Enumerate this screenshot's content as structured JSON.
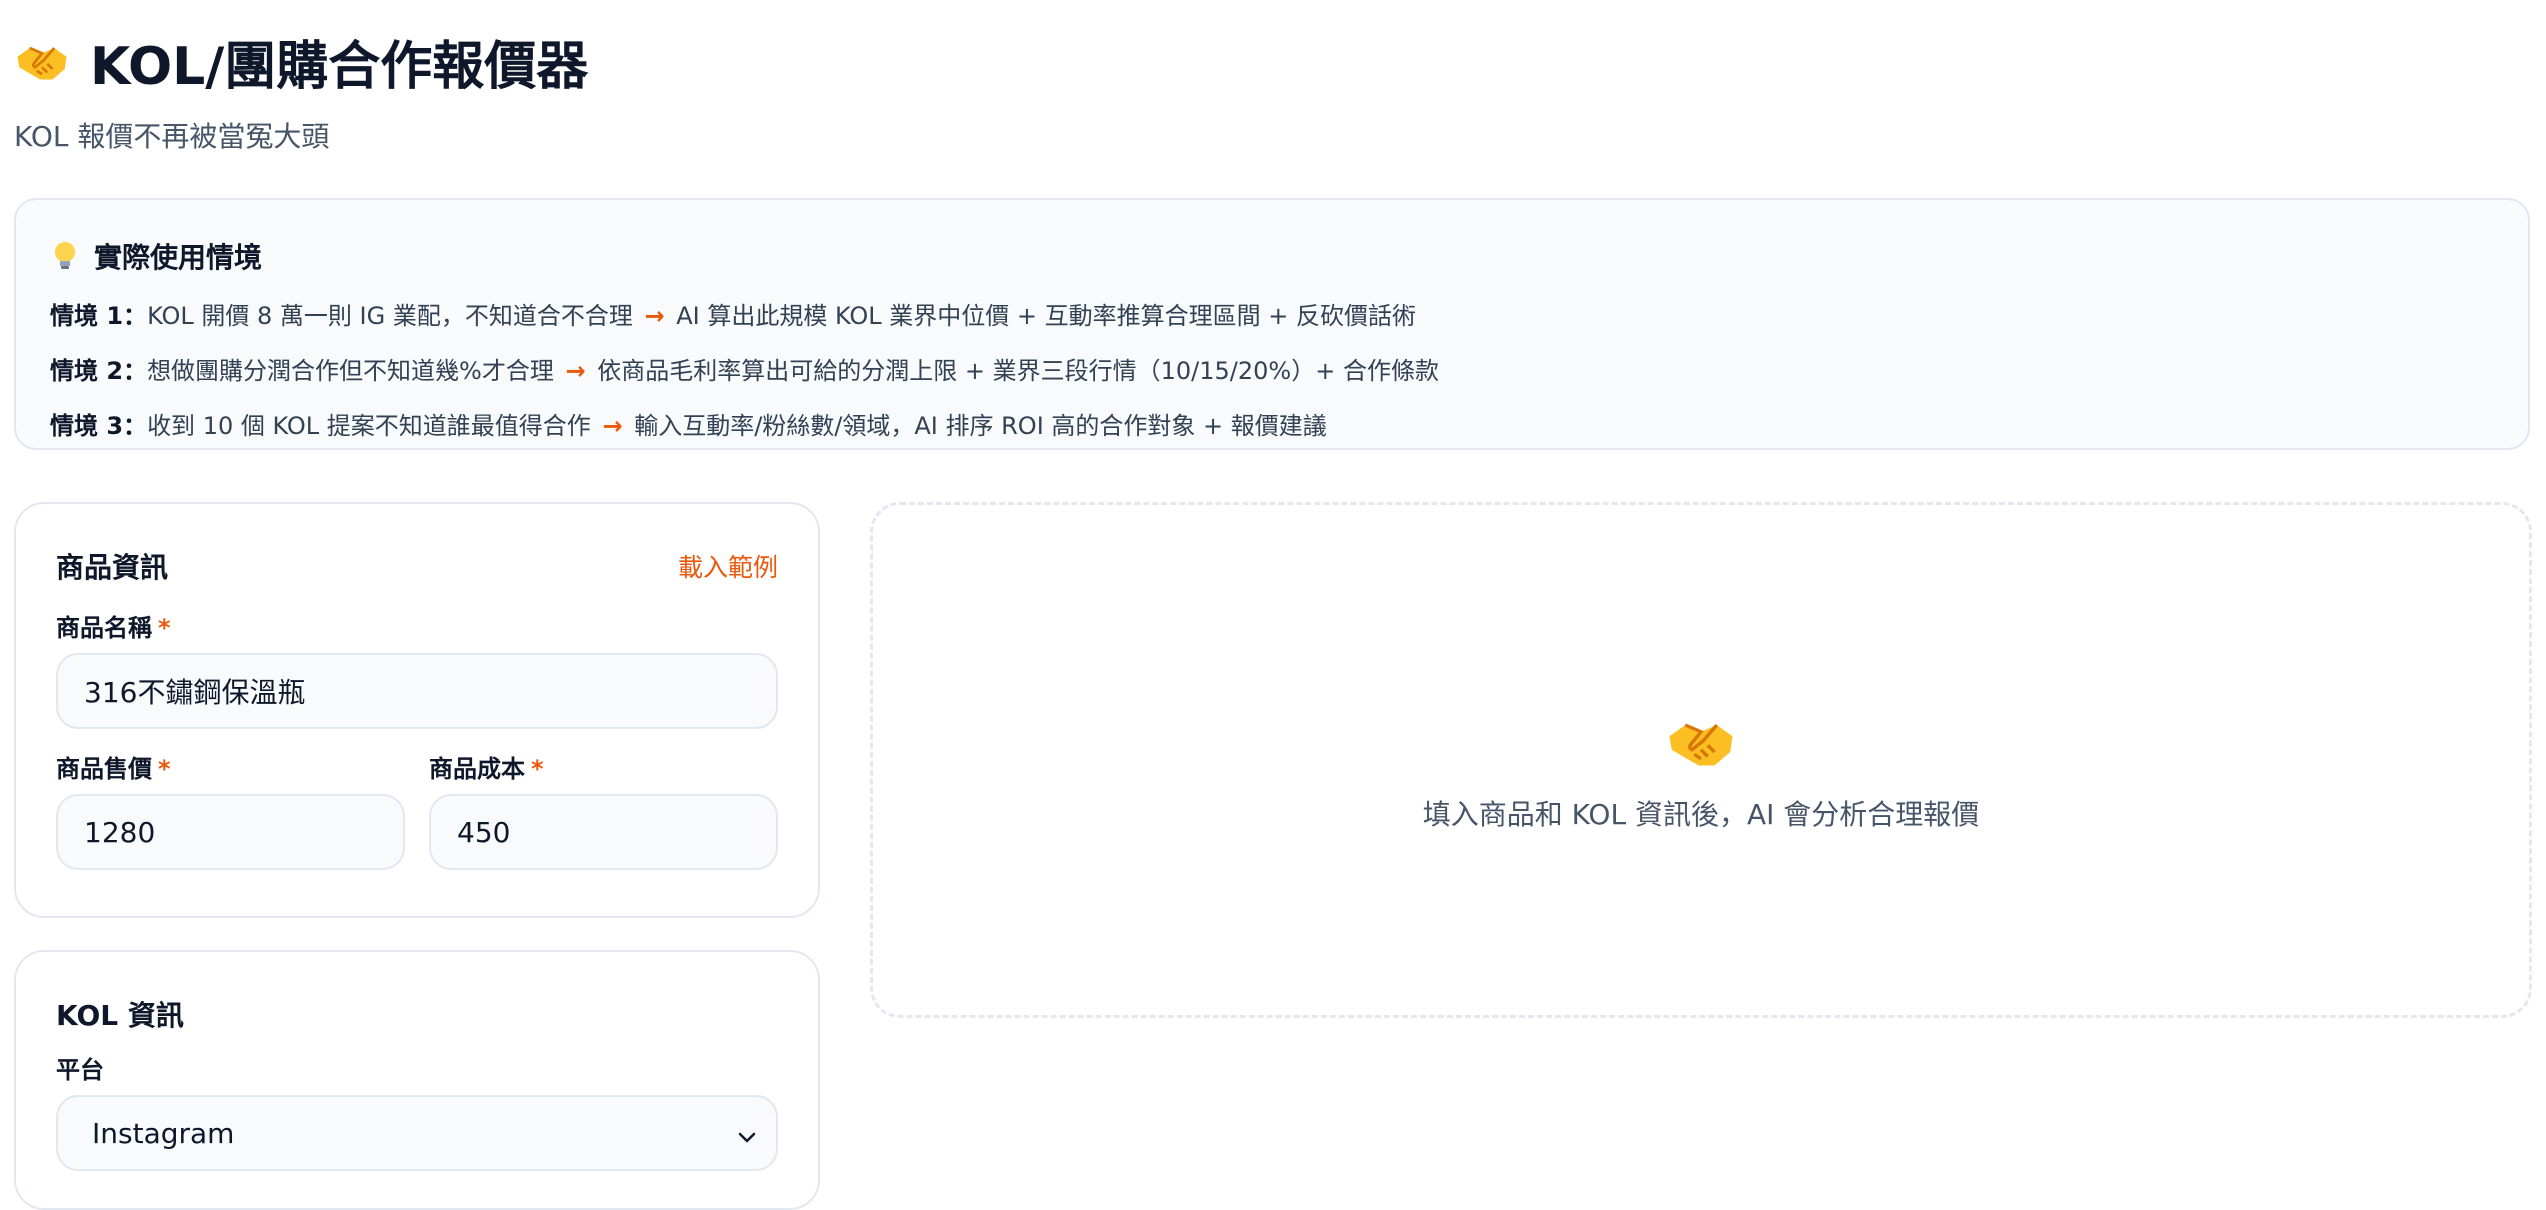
{
  "header": {
    "title": "KOL/團購合作報價器",
    "subtitle": "KOL 報價不再被當冤大頭",
    "icon": "handshake-icon"
  },
  "scenarios": {
    "heading": "實際使用情境",
    "icon": "lightbulb-icon",
    "items": [
      {
        "label": "情境 1：",
        "problem": "KOL 開價 8 萬一則 IG 業配，不知道合不合理",
        "arrow": "→",
        "solution": "AI 算出此規模 KOL 業界中位價 + 互動率推算合理區間 + 反砍價話術"
      },
      {
        "label": "情境 2：",
        "problem": "想做團購分潤合作但不知道幾%才合理",
        "arrow": "→",
        "solution": "依商品毛利率算出可給的分潤上限 + 業界三段行情（10/15/20%）+ 合作條款"
      },
      {
        "label": "情境 3：",
        "problem": "收到 10 個 KOL 提案不知道誰最值得合作",
        "arrow": "→",
        "solution": "輸入互動率/粉絲數/領域，AI 排序 ROI 高的合作對象 + 報價建議"
      }
    ]
  },
  "product_card": {
    "title": "商品資訊",
    "load_example": "載入範例",
    "name_label": "商品名稱",
    "name_value": "316不鏽鋼保溫瓶",
    "price_label": "商品售價",
    "price_value": "1280",
    "cost_label": "商品成本",
    "cost_value": "450",
    "required_mark": "*"
  },
  "kol_card": {
    "title": "KOL 資訊",
    "platform_label": "平台",
    "platform_value": "Instagram"
  },
  "result": {
    "icon": "handshake-icon",
    "placeholder": "填入商品和 KOL 資訊後，AI 會分析合理報價"
  },
  "colors": {
    "accent": "#ea580c",
    "border": "#e2e8f0",
    "input_bg": "#f8fafc",
    "text": "#0f172a",
    "muted": "#475569"
  }
}
